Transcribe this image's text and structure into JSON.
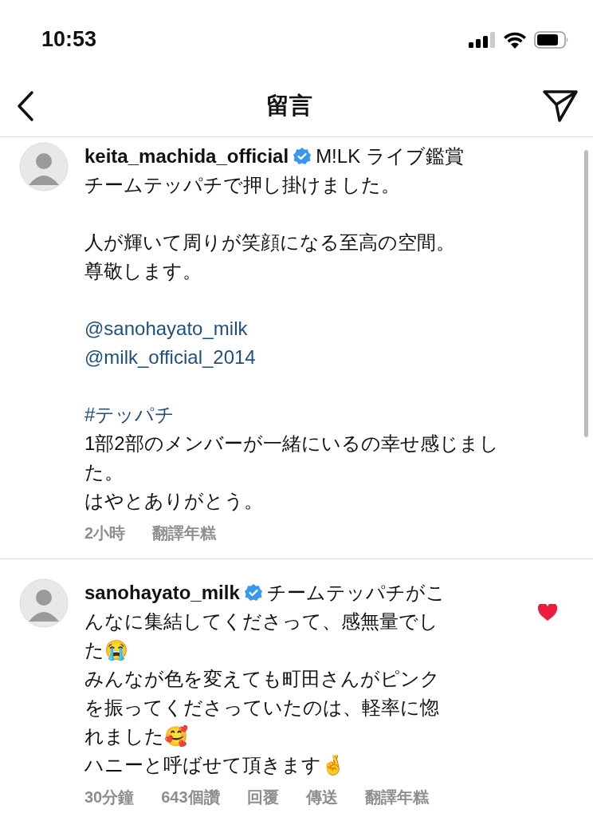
{
  "status_bar": {
    "time": "10:53"
  },
  "header": {
    "title": "留言"
  },
  "comments": [
    {
      "username": "keita_machida_official",
      "verified": true,
      "paragraphs": [
        [
          {
            "kind": "text",
            "text": "M!LK ライブ鑑賞"
          },
          {
            "kind": "text",
            "text": "チームテッパチで押し掛けました。"
          }
        ],
        [
          {
            "kind": "text",
            "text": "人が輝いて周りが笑顔になる至高の空間。"
          },
          {
            "kind": "text",
            "text": "尊敬します。"
          }
        ],
        [
          {
            "kind": "mention",
            "text": "@sanohayato_milk"
          },
          {
            "kind": "mention",
            "text": "@milk_official_2014"
          }
        ],
        [
          {
            "kind": "hashtag",
            "text": "#テッパチ"
          },
          {
            "kind": "text",
            "text": "1部2部のメンバーが一緒にいるの幸せ感じまし"
          },
          {
            "kind": "text",
            "text": "た。"
          },
          {
            "kind": "text",
            "text": "はやとありがとう。"
          }
        ]
      ],
      "meta": [
        "2小時",
        "翻譯年糕"
      ]
    },
    {
      "username": "sanohayato_milk",
      "verified": true,
      "liked": true,
      "paragraphs": [
        [
          {
            "kind": "text",
            "text": "チームテッパチがこ"
          },
          {
            "kind": "text",
            "text": "んなに集結してくださって、感無量でし"
          },
          {
            "kind": "text",
            "text": "た😭"
          },
          {
            "kind": "text",
            "text": "みんなが色を変えても町田さんがピンク"
          },
          {
            "kind": "text",
            "text": "を振ってくださっていたのは、軽率に惚"
          },
          {
            "kind": "text",
            "text": "れました🥰"
          },
          {
            "kind": "text",
            "text": "ハニーと呼ばせて頂きます🤞"
          }
        ]
      ],
      "meta": [
        "30分鐘",
        "643個讚",
        "回覆",
        "傳送",
        "翻譯年糕"
      ]
    }
  ]
}
